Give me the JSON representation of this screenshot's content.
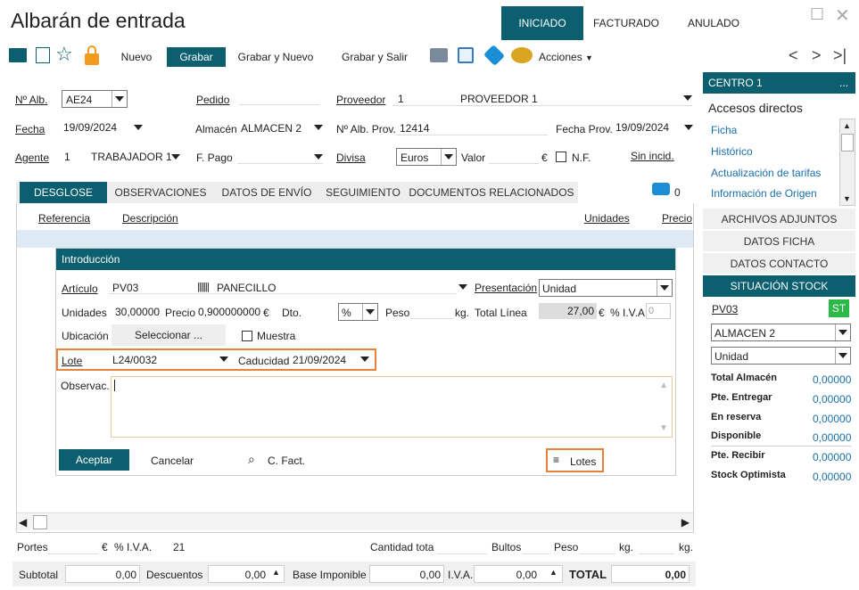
{
  "window": {
    "title": "Albarán de entrada"
  },
  "status_tabs": [
    {
      "label": "INICIADO"
    },
    {
      "label": "FACTURADO"
    },
    {
      "label": "ANULADO"
    }
  ],
  "toolbar": {
    "nuevo": "Nuevo",
    "grabar": "Grabar",
    "grabar_nuevo": "Grabar y Nuevo",
    "grabar_salir": "Grabar y Salir",
    "acciones": "Acciones"
  },
  "header": {
    "n_alb_label": "Nº Alb.",
    "n_alb_value": "AE24",
    "pedido_label": "Pedido",
    "proveedor_label": "Proveedor",
    "proveedor_code": "1",
    "proveedor_name": "PROVEEDOR 1",
    "fecha_label": "Fecha",
    "fecha_value": "19/09/2024",
    "almacen_label": "Almacén",
    "almacen_value": "ALMACEN 2",
    "n_alb_prov_label": "Nº Alb. Prov.",
    "n_alb_prov_value": "12414",
    "fecha_prov_label": "Fecha Prov.",
    "fecha_prov_value": "19/09/2024",
    "agente_label": "Agente",
    "agente_code": "1",
    "agente_name": "TRABAJADOR 1",
    "fpago_label": "F. Pago",
    "divisa_label": "Divisa",
    "divisa_value": "Euros",
    "valor_label": "Valor",
    "valor_unit": "€",
    "nf_label": "N.F.",
    "sin_incid": "Sin incid."
  },
  "tabs": [
    {
      "label": "DESGLOSE"
    },
    {
      "label": "OBSERVACIONES"
    },
    {
      "label": "DATOS DE ENVÍO"
    },
    {
      "label": "SEGUIMIENTO"
    },
    {
      "label": "DOCUMENTOS RELACIONADOS"
    }
  ],
  "comments_count": "0",
  "grid": {
    "col_referencia": "Referencia",
    "col_descripcion": "Descripción",
    "col_unidades": "Unidades",
    "col_precio": "Precio"
  },
  "dialog": {
    "title": "Introducción",
    "articulo_label": "Artículo",
    "articulo_code": "PV03",
    "articulo_name": "PANECILLO",
    "presentacion_label": "Presentación",
    "presentacion_value": "Unidad",
    "unidades_label": "Unidades",
    "unidades_value": "30,00000",
    "precio_label": "Precio",
    "precio_value": "0,900000000",
    "precio_unit": "€",
    "dto_label": "Dto.",
    "dto_value": "%",
    "peso_label": "Peso",
    "peso_unit": "kg.",
    "total_linea_label": "Total Línea",
    "total_linea_value": "27,00",
    "total_unit": "€",
    "iva_label": "% I.V.A.",
    "iva_value": "0",
    "ubicacion_label": "Ubicación",
    "seleccionar": "Seleccionar ...",
    "muestra_label": "Muestra",
    "lote_label": "Lote",
    "lote_value": "L24/0032",
    "caducidad_label": "Caducidad",
    "caducidad_value": "21/09/2024",
    "observ_label": "Observac.",
    "aceptar": "Aceptar",
    "cancelar": "Cancelar",
    "cfact": "C. Fact.",
    "lotes": "Lotes"
  },
  "footer": {
    "portes_label": "Portes",
    "portes_unit": "€",
    "iva_label": "% I.V.A.",
    "iva_value": "21",
    "cantidad_label": "Cantidad tota",
    "bultos_label": "Bultos",
    "peso_label": "Peso",
    "kg1": "kg.",
    "kg2": "kg.",
    "subtotal_label": "Subtotal",
    "subtotal_value": "0,00",
    "descuentos_label": "Descuentos",
    "descuentos_value": "0,00",
    "base_label": "Base Imponible",
    "base_value": "0,00",
    "iva2_label": "I.V.A.",
    "iva2_value": "0,00",
    "total_label": "TOTAL",
    "total_value": "0,00"
  },
  "right_panel": {
    "centro": "CENTRO 1",
    "more": "...",
    "accesos": "Accesos directos",
    "links": [
      {
        "label": "Ficha"
      },
      {
        "label": "Histórico"
      },
      {
        "label": "Actualización de tarifas"
      },
      {
        "label": "Información de Origen"
      }
    ],
    "sections": [
      {
        "label": "ARCHIVOS ADJUNTOS"
      },
      {
        "label": "DATOS FICHA"
      },
      {
        "label": "DATOS CONTACTO"
      }
    ],
    "stock_title": "SITUACIÓN STOCK",
    "stock_item": "PV03",
    "stock_badge": "ST",
    "almacen": "ALMACEN 2",
    "unidad": "Unidad",
    "stock_rows": [
      {
        "label": "Total Almacén",
        "value": "0,00000"
      },
      {
        "label": "Pte. Entregar",
        "value": "0,00000"
      },
      {
        "label": "En reserva",
        "value": "0,00000"
      },
      {
        "label": "Disponible",
        "value": "0,00000"
      },
      {
        "label": "Pte. Recibir",
        "value": "0,00000"
      },
      {
        "label": "Stock Optimista",
        "value": "0,00000"
      }
    ]
  },
  "colors": {
    "teal": "#0b5f6e",
    "orange": "#e8823a",
    "link": "#1a6fa8",
    "green": "#2db84a"
  }
}
